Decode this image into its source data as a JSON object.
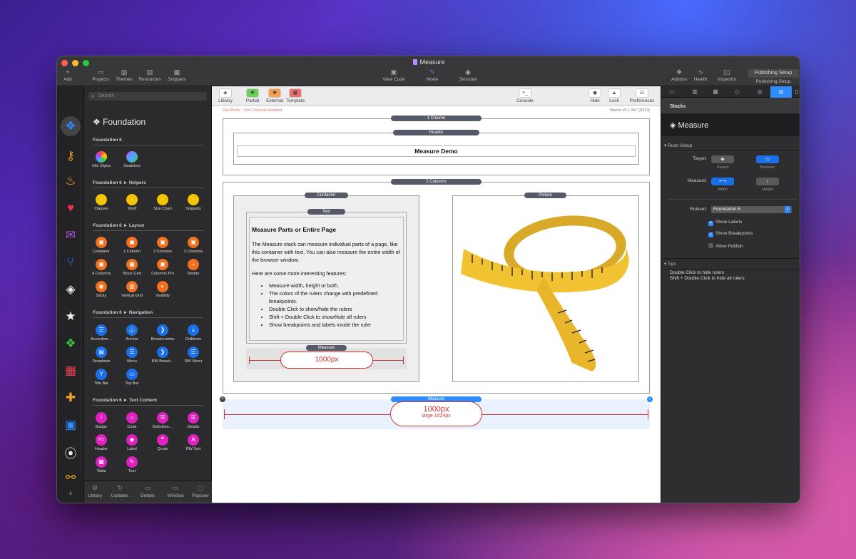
{
  "window": {
    "title": "Measure"
  },
  "toolbar": {
    "add": "Add",
    "projects": "Projects",
    "themes": "Themes",
    "resources": "Resources",
    "snippets": "Snippets",
    "view_code": "View Code",
    "mode": "Mode",
    "simulate": "Simulate",
    "addons": "Addons",
    "health": "Health",
    "inspector": "Inspector",
    "publishing_setup": "Publishing Setup"
  },
  "library": {
    "search_placeholder": "Search",
    "title": "Foundation",
    "sections": [
      {
        "name": "Foundation 6",
        "items": [
          "Site Styles",
          "Swatches"
        ]
      },
      {
        "name": "Foundation 6 ► Helpers",
        "items": [
          "Classes",
          "Shelf",
          "Size Chart",
          "Snippets"
        ]
      },
      {
        "name": "Foundation 6 ► Layout",
        "items": [
          "Container",
          "1 Column",
          "2 Columns",
          "3 Columns",
          "4 Columns",
          "Block Grid",
          "Columns Pro",
          "Divider",
          "Sticky",
          "Vertical Grid",
          "Visibility"
        ]
      },
      {
        "name": "Foundation 6 ► Navigation",
        "items": [
          "Accordion…",
          "Anchor",
          "Breadcrumbs",
          "Drilldown",
          "Dropdown",
          "Menu",
          "RW Bread…",
          "RW Menu",
          "Title Bar",
          "Top Bar"
        ]
      },
      {
        "name": "Foundation 6 ► Text Content",
        "items": [
          "Badge",
          "Code",
          "Definition…",
          "Details",
          "Header",
          "Label",
          "Quote",
          "RW Text",
          "Table",
          "Text"
        ]
      }
    ],
    "bottom": [
      "Library",
      "Updates",
      "Details",
      "Window",
      "Popover"
    ]
  },
  "canvas_toolbar": {
    "library": "Library",
    "partial": "Partial",
    "external": "External",
    "template": "Template",
    "console": "Console",
    "hide": "Hide",
    "lock": "Lock",
    "preferences": "Preferences"
  },
  "canvas": {
    "dev_prefs": "Dev Prefs :: Dev Console Enabled",
    "stacks_version": "Stacks v5.1.2b7 (5313)",
    "one_column": "1 Column",
    "header": "Header",
    "demo_title": "Measure Demo",
    "two_columns": "2 Columns",
    "container": "Container",
    "picture": "Picture",
    "text": "Text",
    "heading": "Measure Parts or Entire Page",
    "para1": "The Measure stack can measure individual parts of a page, like this container with text. You can also measure the entire width of the browser window.",
    "para2": "Here are some more interesting features:",
    "bullets": [
      "Measure width, height or both.",
      "The colors of the rulers change with predefined breakpoints.",
      "Double Click to show/hide the rulers",
      "Shift + Double Click to show/hide all rulers",
      "Show breakpoints and labels inside the ruler"
    ],
    "measure_label": "Measure",
    "inner_measure_value": "1000px",
    "outer_measure_value": "1000px",
    "outer_measure_sub": "large 1024px"
  },
  "inspector": {
    "panel": "Stacks",
    "title": "Measure",
    "ruler_setup": "Ruler Setup",
    "target_label": "Target:",
    "target_parent": "Parent",
    "target_browser": "Browser",
    "measure_label": "Measure:",
    "measure_width": "Width",
    "measure_height": "Height",
    "ruleset_label": "Ruleset:",
    "ruleset_value": "Foundation 6",
    "show_labels": "Show Labels",
    "show_breakpoints": "Show Breakpoints",
    "allow_publish": "Allow Publish",
    "tips": "Tips",
    "tip1": "Double Click to hide rulers",
    "tip2": "Shift + Double Click to hide all rulers"
  }
}
